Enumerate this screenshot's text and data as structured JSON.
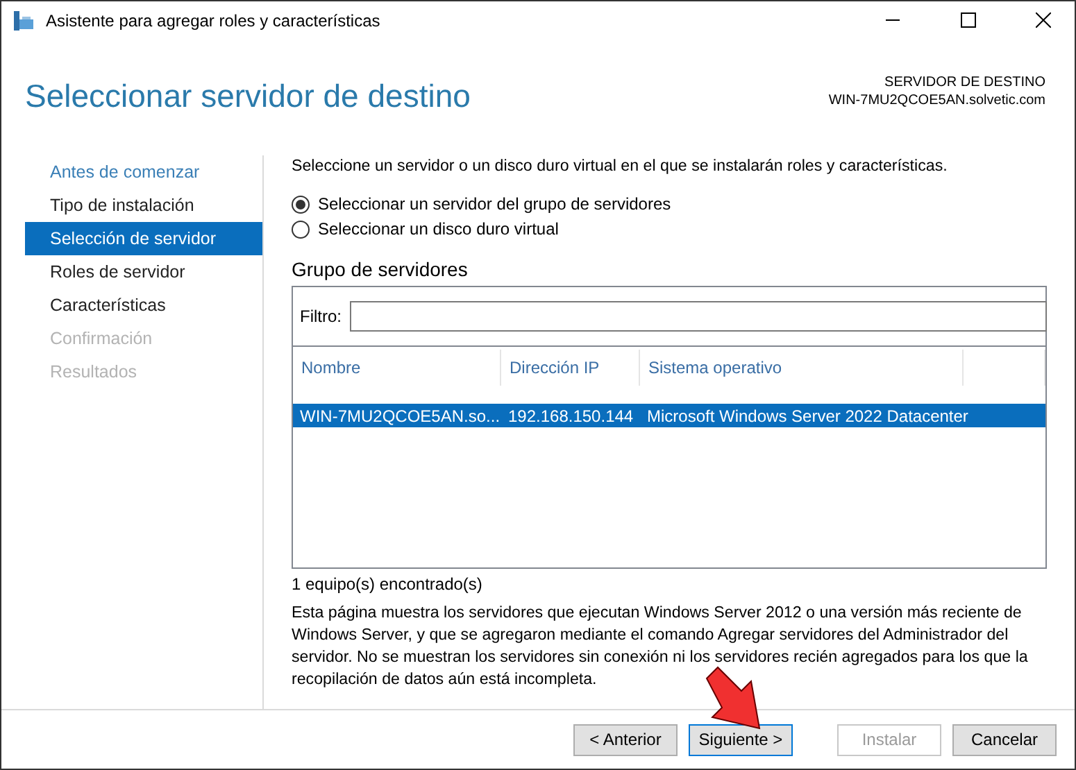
{
  "window": {
    "title": "Asistente para agregar roles y características"
  },
  "header": {
    "title": "Seleccionar servidor de destino",
    "server_label": "SERVIDOR DE DESTINO",
    "server_name": "WIN-7MU2QCOE5AN.solvetic.com"
  },
  "sidebar": {
    "items": [
      {
        "label": "Antes de comenzar",
        "visited": true,
        "selected": false,
        "disabled": false
      },
      {
        "label": "Tipo de instalación",
        "visited": false,
        "selected": false,
        "disabled": false
      },
      {
        "label": "Selección de servidor",
        "visited": false,
        "selected": true,
        "disabled": false
      },
      {
        "label": "Roles de servidor",
        "visited": false,
        "selected": false,
        "disabled": false
      },
      {
        "label": "Características",
        "visited": false,
        "selected": false,
        "disabled": false
      },
      {
        "label": "Confirmación",
        "visited": false,
        "selected": false,
        "disabled": true
      },
      {
        "label": "Resultados",
        "visited": false,
        "selected": false,
        "disabled": true
      }
    ]
  },
  "intro": "Seleccione un servidor o un disco duro virtual en el que se instalarán roles y características.",
  "options": [
    {
      "label": "Seleccionar un servidor del grupo de servidores",
      "selected": true
    },
    {
      "label": "Seleccionar un disco duro virtual",
      "selected": false
    }
  ],
  "group": {
    "title": "Grupo de servidores",
    "filter_label": "Filtro:",
    "table": {
      "columns": [
        "Nombre",
        "Dirección IP",
        "Sistema operativo"
      ],
      "rows": [
        {
          "cells": [
            "WIN-7MU2QCOE5AN.so...",
            "192.168.150.144",
            "Microsoft Windows Server 2022 Datacenter"
          ],
          "selected": true
        }
      ]
    },
    "count": "1 equipo(s) encontrado(s)"
  },
  "note": "Esta página muestra los servidores que ejecutan Windows Server 2012 o una versión más reciente de Windows Server, y que se agregaron mediante el comando Agregar servidores del Administrador del servidor. No se muestran los servidores sin conexión ni los servidores recién agregados para los que la recopilación de datos aún está incompleta.",
  "buttons": [
    {
      "label": "< Anterior",
      "default": false,
      "disabled": false
    },
    {
      "label": "Siguiente >",
      "default": true,
      "disabled": false
    },
    {
      "label": "Instalar",
      "default": false,
      "disabled": true
    },
    {
      "label": "Cancelar",
      "default": false,
      "disabled": false
    }
  ]
}
